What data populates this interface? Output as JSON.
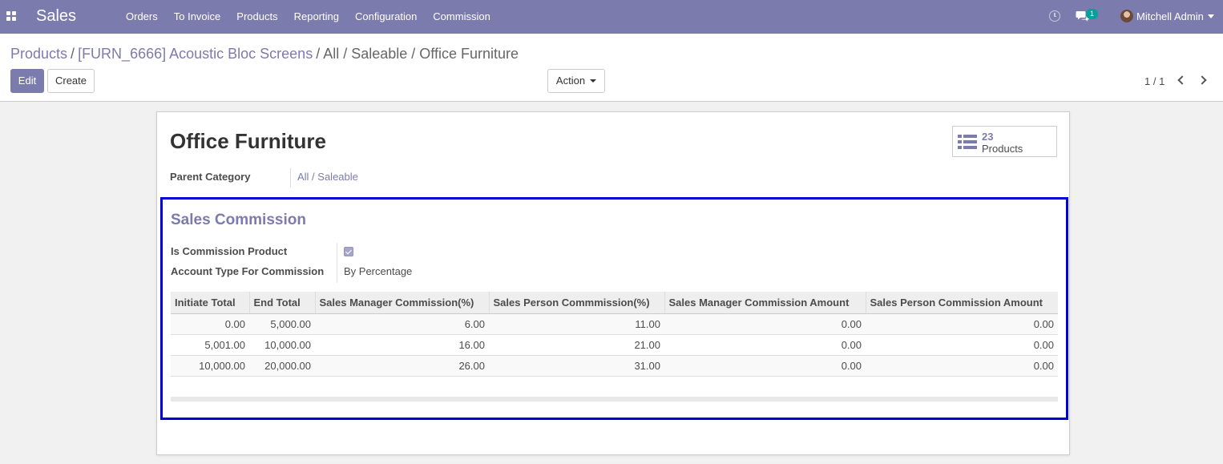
{
  "navbar": {
    "app_name": "Sales",
    "menu": [
      "Orders",
      "To Invoice",
      "Products",
      "Reporting",
      "Configuration",
      "Commission"
    ],
    "chat_badge": "1",
    "user_name": "Mitchell Admin"
  },
  "breadcrumb": {
    "items": [
      "Products",
      "[FURN_6666] Acoustic Bloc Screens"
    ],
    "separator": "/",
    "active": "All / Saleable / Office Furniture"
  },
  "buttons": {
    "edit": "Edit",
    "create": "Create",
    "action": "Action"
  },
  "pager": "1 / 1",
  "record": {
    "title": "Office Furniture",
    "stat_button": {
      "value": "23",
      "label": "Products"
    },
    "parent_category_label": "Parent Category",
    "parent_category_value": "All / Saleable"
  },
  "commission": {
    "section_title": "Sales Commission",
    "is_commission_product_label": "Is Commission Product",
    "is_commission_product": true,
    "account_type_label": "Account Type For Commission",
    "account_type_value": "By Percentage",
    "columns": [
      "Initiate Total",
      "End Total",
      "Sales Manager Commission(%)",
      "Sales Person Commmission(%)",
      "Sales Manager Commission Amount",
      "Sales Person Commission Amount"
    ],
    "rows": [
      [
        "0.00",
        "5,000.00",
        "6.00",
        "11.00",
        "0.00",
        "0.00"
      ],
      [
        "5,001.00",
        "10,000.00",
        "16.00",
        "21.00",
        "0.00",
        "0.00"
      ],
      [
        "10,000.00",
        "20,000.00",
        "26.00",
        "31.00",
        "0.00",
        "0.00"
      ]
    ]
  },
  "colors": {
    "brand": "#7c7bad",
    "highlight_border": "#0000d6",
    "badge": "#00a09d"
  }
}
